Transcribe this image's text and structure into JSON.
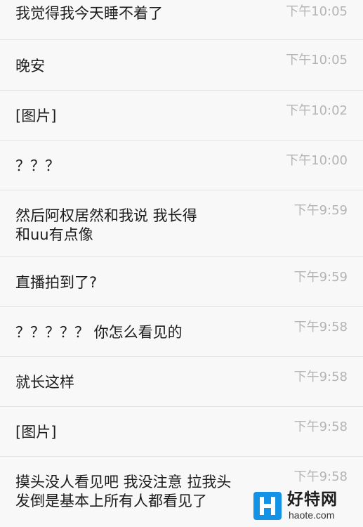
{
  "messages": [
    {
      "text": "我觉得我今天睡不着了",
      "time": "下午10:05"
    },
    {
      "text": "晚安",
      "time": "下午10:05"
    },
    {
      "text": "[图片]",
      "time": "下午10:02"
    },
    {
      "text": "？？？",
      "time": "下午10:00"
    },
    {
      "text": "然后阿权居然和我说 我长得\n和uu有点像",
      "time": "下午9:59"
    },
    {
      "text": "直播拍到了?",
      "time": "下午9:59"
    },
    {
      "text": "？？？？？ 你怎么看见的",
      "time": "下午9:58"
    },
    {
      "text": "就长这样",
      "time": "下午9:58"
    },
    {
      "text": "[图片]",
      "time": "下午9:58"
    },
    {
      "text": "摸头没人看见吧 我没注意 拉我头\n发倒是基本上所有人都看见了",
      "time": "下午9:58"
    }
  ],
  "watermark": {
    "title": "好特网",
    "url": "haote.com",
    "color": "#1493e6"
  }
}
